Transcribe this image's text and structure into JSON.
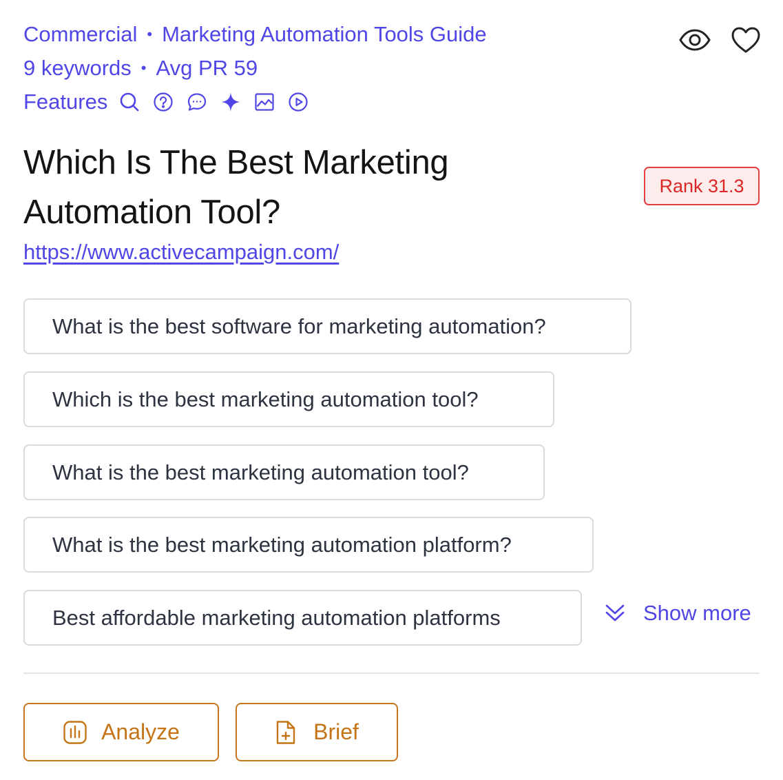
{
  "meta": {
    "category": "Commercial",
    "guide": "Marketing Automation Tools Guide",
    "keywords": "9 keywords",
    "avg_pr": "Avg PR 59",
    "features_label": "Features",
    "feature_icons": [
      "search-icon",
      "question-icon",
      "chat-icon",
      "sparkle-icon",
      "image-icon",
      "play-icon"
    ]
  },
  "top_actions": [
    "eye-icon",
    "heart-icon"
  ],
  "title": "Which Is The Best Marketing Automation Tool?",
  "rank": "Rank 31.3",
  "url": "https://www.activecampaign.com/",
  "keywords_list": [
    "What is the best software for marketing automation?",
    "Which is the best marketing automation tool?",
    "What is the best marketing automation tool?",
    "What is the best marketing automation platform?",
    "Best affordable marketing automation platforms"
  ],
  "show_more": "Show more",
  "buttons": {
    "analyze": "Analyze",
    "brief": "Brief"
  },
  "colors": {
    "accent": "#4f46e5",
    "rank_red": "#dc2626",
    "button_orange": "#c47414"
  }
}
